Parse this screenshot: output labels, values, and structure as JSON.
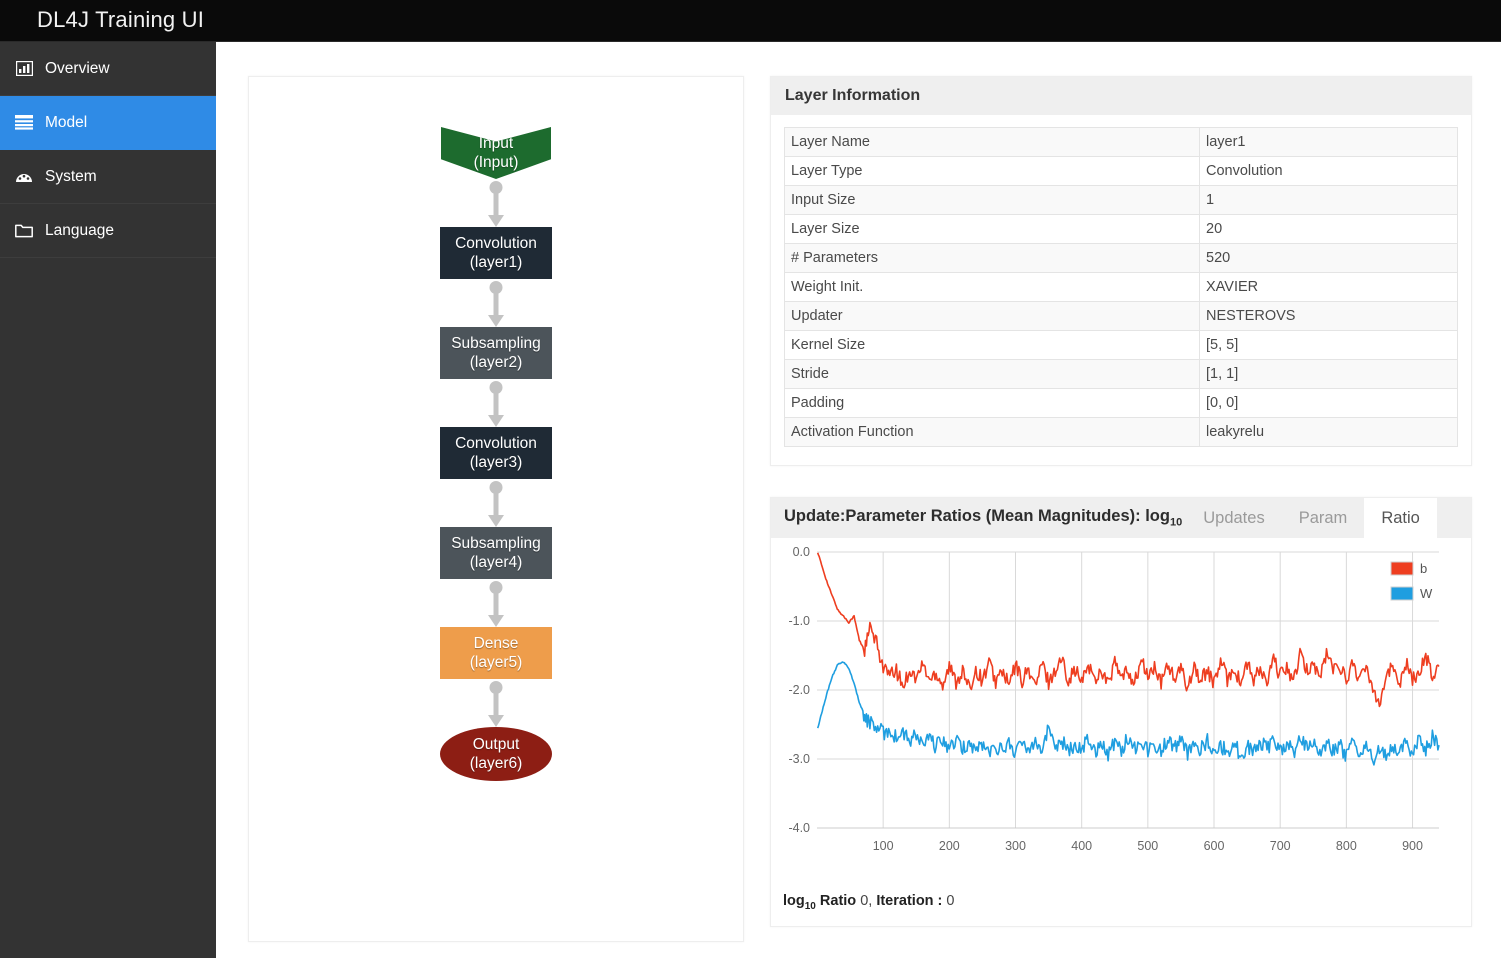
{
  "app": {
    "title": "DL4J Training UI",
    "header_bg": "#0a0a0a",
    "sidebar_bg": "#333333",
    "accent": "#2f8be6"
  },
  "sidebar": {
    "items": [
      {
        "label": "Overview",
        "icon": "bar-chart-icon",
        "active": false
      },
      {
        "label": "Model",
        "icon": "server-list-icon",
        "active": true
      },
      {
        "label": "System",
        "icon": "dashboard-gauge-icon",
        "active": false
      },
      {
        "label": "Language",
        "icon": "folder-icon",
        "active": false
      }
    ]
  },
  "model_graph": {
    "nodes": [
      {
        "type": "Input",
        "name": "(Input)",
        "shape": "vee",
        "color": "#1d6b2e"
      },
      {
        "type": "Convolution",
        "name": "(layer1)",
        "shape": "rect",
        "color": "#1f2a35"
      },
      {
        "type": "Subsampling",
        "name": "(layer2)",
        "shape": "rect",
        "color": "#4c545a"
      },
      {
        "type": "Convolution",
        "name": "(layer3)",
        "shape": "rect",
        "color": "#1f2a35"
      },
      {
        "type": "Subsampling",
        "name": "(layer4)",
        "shape": "rect",
        "color": "#4c545a"
      },
      {
        "type": "Dense",
        "name": "(layer5)",
        "shape": "rect",
        "color": "#ee9d4b"
      },
      {
        "type": "Output",
        "name": "(layer6)",
        "shape": "ellipse",
        "color": "#8d1e14"
      }
    ]
  },
  "layer_information": {
    "title": "Layer Information",
    "rows": [
      {
        "key": "Layer Name",
        "value": "layer1"
      },
      {
        "key": "Layer Type",
        "value": "Convolution"
      },
      {
        "key": "Input Size",
        "value": "1"
      },
      {
        "key": "Layer Size",
        "value": "20"
      },
      {
        "key": "# Parameters",
        "value": "520"
      },
      {
        "key": "Weight Init.",
        "value": "XAVIER"
      },
      {
        "key": "Updater",
        "value": "NESTEROVS"
      },
      {
        "key": "Kernel Size",
        "value": "[5, 5]"
      },
      {
        "key": "Stride",
        "value": "[1, 1]"
      },
      {
        "key": "Padding",
        "value": "[0, 0]"
      },
      {
        "key": "Activation Function",
        "value": "leakyrelu"
      }
    ]
  },
  "ratios_card": {
    "title_main": "Update:Parameter Ratios (Mean Magnitudes): log",
    "title_sub": "10",
    "tabs": [
      {
        "label": "Updates",
        "active": false
      },
      {
        "label": "Param",
        "active": false
      },
      {
        "label": "Ratio",
        "active": true
      }
    ],
    "footer": {
      "prefix": "log",
      "prefix_sub": "10",
      "metric_label": "Ratio",
      "metric_value": "0",
      "separator": ",",
      "iteration_label": "Iteration :",
      "iteration_value": "0"
    }
  },
  "chart_data": {
    "type": "line",
    "title": "Update:Parameter Ratios (Mean Magnitudes): log10",
    "xlabel": "",
    "ylabel": "",
    "xlim": [
      0,
      940
    ],
    "ylim": [
      -4.0,
      0.0
    ],
    "xticks": [
      100,
      200,
      300,
      400,
      500,
      600,
      700,
      800,
      900
    ],
    "yticks": [
      "0.0",
      "-1.0",
      "-2.0",
      "-3.0",
      "-4.0"
    ],
    "grid": true,
    "legend_position": "top-right",
    "series": [
      {
        "name": "b",
        "color": "#ee3e20",
        "x": [
          1,
          8,
          16,
          24,
          32,
          40,
          48,
          56,
          64,
          72,
          80,
          90,
          100,
          110,
          120,
          130,
          140,
          150,
          160,
          170,
          180,
          190,
          200,
          210,
          220,
          230,
          240,
          250,
          260,
          270,
          280,
          290,
          300,
          310,
          320,
          330,
          340,
          350,
          360,
          370,
          380,
          390,
          400,
          410,
          420,
          430,
          440,
          450,
          460,
          470,
          480,
          490,
          500,
          510,
          520,
          530,
          540,
          550,
          560,
          570,
          580,
          590,
          600,
          610,
          620,
          630,
          640,
          650,
          660,
          670,
          680,
          690,
          700,
          710,
          720,
          730,
          740,
          750,
          760,
          770,
          780,
          790,
          800,
          810,
          820,
          830,
          840,
          850,
          860,
          870,
          880,
          890,
          900,
          910,
          920,
          930,
          940
        ],
        "y": [
          0.0,
          -0.22,
          -0.46,
          -0.66,
          -0.85,
          -0.93,
          -1.02,
          -0.93,
          -1.28,
          -1.42,
          -1.1,
          -1.33,
          -1.66,
          -1.8,
          -1.72,
          -1.95,
          -1.7,
          -1.84,
          -1.62,
          -1.86,
          -1.74,
          -1.92,
          -1.66,
          -1.88,
          -1.72,
          -2.0,
          -1.7,
          -1.86,
          -1.6,
          -1.88,
          -1.72,
          -1.94,
          -1.64,
          -1.86,
          -1.7,
          -1.95,
          -1.62,
          -1.88,
          -1.72,
          -1.55,
          -1.84,
          -1.7,
          -1.9,
          -1.62,
          -1.86,
          -1.7,
          -1.92,
          -1.6,
          -1.84,
          -1.72,
          -1.9,
          -1.58,
          -1.8,
          -1.68,
          -1.92,
          -1.6,
          -1.86,
          -1.7,
          -1.95,
          -1.64,
          -1.88,
          -1.7,
          -1.92,
          -1.58,
          -1.84,
          -1.68,
          -1.9,
          -1.62,
          -1.86,
          -1.7,
          -1.92,
          -1.55,
          -1.8,
          -1.66,
          -1.88,
          -1.5,
          -1.72,
          -1.6,
          -1.84,
          -1.45,
          -1.7,
          -1.62,
          -1.88,
          -1.58,
          -1.86,
          -1.68,
          -1.95,
          -2.18,
          -1.8,
          -1.66,
          -1.9,
          -1.6,
          -1.86,
          -1.72,
          -1.5,
          -1.8,
          -1.66
        ]
      },
      {
        "name": "W",
        "color": "#1f9ee0",
        "x": [
          1,
          8,
          16,
          24,
          32,
          40,
          48,
          56,
          64,
          72,
          80,
          90,
          100,
          110,
          120,
          130,
          140,
          150,
          160,
          170,
          180,
          190,
          200,
          210,
          220,
          230,
          240,
          250,
          260,
          270,
          280,
          290,
          300,
          310,
          320,
          330,
          340,
          350,
          360,
          370,
          380,
          390,
          400,
          410,
          420,
          430,
          440,
          450,
          460,
          470,
          480,
          490,
          500,
          510,
          520,
          530,
          540,
          550,
          560,
          570,
          580,
          590,
          600,
          610,
          620,
          630,
          640,
          650,
          660,
          670,
          680,
          690,
          700,
          710,
          720,
          730,
          740,
          750,
          760,
          770,
          780,
          790,
          800,
          810,
          820,
          830,
          840,
          850,
          860,
          870,
          880,
          890,
          900,
          910,
          920,
          930,
          940
        ],
        "y": [
          -2.56,
          -2.3,
          -2.02,
          -1.78,
          -1.62,
          -1.6,
          -1.68,
          -1.9,
          -2.18,
          -2.38,
          -2.48,
          -2.55,
          -2.62,
          -2.58,
          -2.7,
          -2.62,
          -2.75,
          -2.66,
          -2.8,
          -2.7,
          -2.82,
          -2.72,
          -2.85,
          -2.74,
          -2.86,
          -2.76,
          -2.88,
          -2.78,
          -2.92,
          -2.8,
          -2.88,
          -2.76,
          -2.9,
          -2.78,
          -2.85,
          -2.7,
          -2.88,
          -2.55,
          -2.8,
          -2.72,
          -2.9,
          -2.78,
          -2.86,
          -2.7,
          -2.88,
          -2.76,
          -2.92,
          -2.74,
          -2.86,
          -2.7,
          -2.84,
          -2.72,
          -2.88,
          -2.76,
          -2.9,
          -2.7,
          -2.84,
          -2.74,
          -2.92,
          -2.78,
          -2.86,
          -2.72,
          -2.96,
          -2.8,
          -2.9,
          -2.76,
          -2.94,
          -2.82,
          -2.88,
          -2.74,
          -2.86,
          -2.7,
          -2.88,
          -2.76,
          -2.92,
          -2.68,
          -2.84,
          -2.74,
          -2.9,
          -2.78,
          -2.86,
          -2.8,
          -2.95,
          -2.78,
          -2.92,
          -2.82,
          -3.02,
          -2.86,
          -2.96,
          -2.8,
          -2.94,
          -2.78,
          -2.9,
          -2.74,
          -2.88,
          -2.68,
          -2.8
        ]
      }
    ]
  }
}
